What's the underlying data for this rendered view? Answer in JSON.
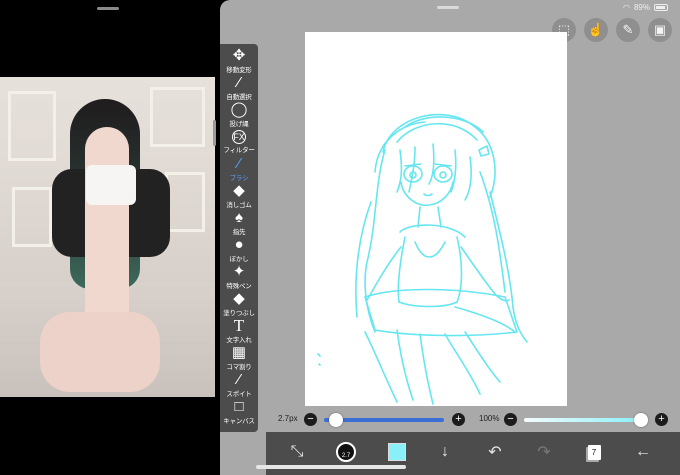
{
  "status_bar": {
    "battery_text": "89%"
  },
  "top_tools": [
    {
      "icon": "selection-icon",
      "glyph": "⬚"
    },
    {
      "icon": "hand-icon",
      "glyph": "☝"
    },
    {
      "icon": "pencil-icon",
      "glyph": "✎"
    },
    {
      "icon": "image-icon",
      "glyph": "▣"
    }
  ],
  "toolbox": {
    "items": [
      {
        "label": "移動変形",
        "icon": "move-transform-icon",
        "glyph": "✥"
      },
      {
        "label": "自動選択",
        "icon": "magic-wand-icon",
        "glyph": "⁄"
      },
      {
        "label": "投げ縄",
        "icon": "lasso-icon",
        "glyph": "◯"
      },
      {
        "label": "フィルター",
        "icon": "filter-fx-icon",
        "glyph": "FX"
      },
      {
        "label": "ブラシ",
        "icon": "brush-icon",
        "glyph": "⁄"
      },
      {
        "label": "消しゴム",
        "icon": "eraser-icon",
        "glyph": "◆"
      },
      {
        "label": "指先",
        "icon": "finger-icon",
        "glyph": "♠"
      },
      {
        "label": "ぼかし",
        "icon": "blur-drop-icon",
        "glyph": "●"
      },
      {
        "label": "特殊ペン",
        "icon": "special-pen-icon",
        "glyph": "✦"
      },
      {
        "label": "塗りつぶし",
        "icon": "fill-bucket-icon",
        "glyph": "◆"
      },
      {
        "label": "文字入れ",
        "icon": "text-tool-icon",
        "glyph": "T"
      },
      {
        "label": "コマ割り",
        "icon": "frame-divider-icon",
        "glyph": "▦"
      },
      {
        "label": "スポイト",
        "icon": "eyedropper-icon",
        "glyph": "⁄"
      },
      {
        "label": "キャンバス",
        "icon": "canvas-icon",
        "glyph": "□"
      }
    ],
    "active_index": 4
  },
  "brush_size": {
    "text": "2.7px",
    "value_fraction": 0.05
  },
  "opacity": {
    "text": "100%",
    "value_fraction": 1.0
  },
  "bottom_bar": {
    "brush_size_badge": "2.7",
    "color": "#8af0f8",
    "layer_count": "7"
  },
  "colors": {
    "sketch_stroke": "#66e6f0",
    "toolbar": "#4c4c4c",
    "active_tool": "#5aa0ff"
  }
}
